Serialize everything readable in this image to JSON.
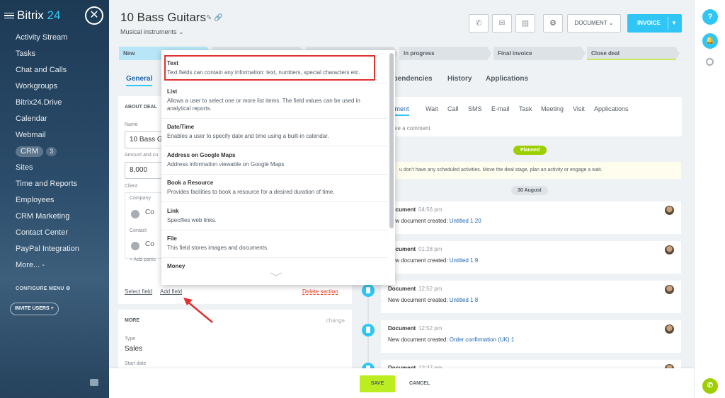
{
  "sidebar": {
    "logo_text": "Bitrix",
    "logo_num": "24",
    "items": [
      {
        "label": "Activity Stream"
      },
      {
        "label": "Tasks"
      },
      {
        "label": "Chat and Calls"
      },
      {
        "label": "Workgroups"
      },
      {
        "label": "Bitrix24.Drive"
      },
      {
        "label": "Calendar"
      },
      {
        "label": "Webmail"
      },
      {
        "label": "CRM",
        "badge": "3"
      },
      {
        "label": "Sites"
      },
      {
        "label": "Time and Reports"
      },
      {
        "label": "Employees"
      },
      {
        "label": "CRM Marketing"
      },
      {
        "label": "Contact Center"
      },
      {
        "label": "PayPal Integration"
      },
      {
        "label": "More... -"
      }
    ],
    "configure_menu": "CONFIGURE MENU",
    "invite_users": "INVITE USERS +"
  },
  "header": {
    "title": "10 Bass Guitars",
    "category": "Musical instruments",
    "document_btn": "DOCUMENT",
    "invoice_btn": "INVOICE"
  },
  "stages": [
    "New",
    "In progress",
    "Final invoice",
    "Close deal"
  ],
  "tabs": [
    "General",
    "ependencies",
    "History",
    "Applications"
  ],
  "about_deal": {
    "heading": "ABOUT DEAL",
    "name_label": "Name",
    "name_value": "10 Bass G",
    "amount_label": "Amount and cu",
    "amount_value": "8,000",
    "client_label": "Client",
    "company_label": "Company",
    "company_value": "Co",
    "contact_label": "Contact",
    "contact_value": "Co",
    "add_participant": "+ Add partic",
    "select_field": "Select field",
    "add_field": "Add field",
    "delete_section": "Delete section"
  },
  "more_card": {
    "heading": "MORE",
    "change": "change",
    "type_label": "Type",
    "type_value": "Sales",
    "start_label": "Start date"
  },
  "timeline": {
    "tabs": [
      "mment",
      "Wait",
      "Call",
      "SMS",
      "E-mail",
      "Task",
      "Meeting",
      "Visit",
      "Applications"
    ],
    "comment_placeholder": "ave a comment",
    "planned": "Planned",
    "no_activities": "u don't have any scheduled activities. Move the deal stage, plan an activity or engage a wait.",
    "date_badge": "30 August",
    "items": [
      {
        "title": "Document",
        "time": "04:56 pm",
        "desc": "New document created:",
        "link": "Untitled 1 20"
      },
      {
        "title": "Document",
        "time": "01:28 pm",
        "desc": "New document created:",
        "link": "Untitled 1 9"
      },
      {
        "title": "Document",
        "time": "12:52 pm",
        "desc": "New document created:",
        "link": "Untitled 1 8"
      },
      {
        "title": "Document",
        "time": "12:52 pm",
        "desc": "New document created:",
        "link": "Order confirmation (UK) 1"
      },
      {
        "title": "Document",
        "time": "12:37 pm",
        "desc": "",
        "link": ""
      }
    ]
  },
  "dropdown": {
    "items": [
      {
        "title": "Text",
        "desc": "Text fields can contain any information: text, numbers, special characters etc."
      },
      {
        "title": "List",
        "desc": "Allows a user to select one or more list items. The field values can be used in analytical reports."
      },
      {
        "title": "Date/Time",
        "desc": "Enables a user to specify date and time using a built-in calendar."
      },
      {
        "title": "Address on Google Maps",
        "desc": "Address information viewable on Google Maps"
      },
      {
        "title": "Book a Resource",
        "desc": "Provides facilities to book a resource for a desired duration of time."
      },
      {
        "title": "Link",
        "desc": "Specifies web links."
      },
      {
        "title": "File",
        "desc": "This field stores images and documents."
      },
      {
        "title": "Money",
        "desc": ""
      }
    ]
  },
  "footer": {
    "save": "SAVE",
    "cancel": "CANCEL"
  },
  "rail": {
    "help": "?"
  }
}
